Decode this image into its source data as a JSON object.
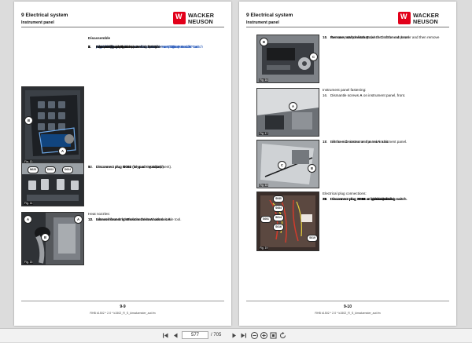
{
  "left_page": {
    "header": {
      "title": "9   Electrical system",
      "subtitle": "Instrument panel"
    },
    "logo": {
      "line1": "WACKER",
      "line2": "NEUSON",
      "mark": "W"
    },
    "disassemble_heading": "Disassemble",
    "steps_a": [
      {
        "n": "1.",
        "text": "Switch off battery master switch ",
        "bold": "S008",
        "ref": " – see \"Battery master switch"
      },
      {
        "n": "",
        "text": "",
        "bold": "",
        "ref": "S008\" on page 1-4."
      },
      {
        "n": "2.",
        "text": "Fit cladding under the instrument panel – ",
        "bold": "",
        "ref": "see \"Disassemble\" on"
      },
      {
        "n": "",
        "text": "",
        "bold": "",
        "ref": "page 12-19."
      },
      {
        "n": "3.",
        "text": "Completely remove the steering column – ",
        "bold": "",
        "ref": "see \"Disassemble\" on"
      },
      {
        "n": "",
        "text": "",
        "bold": "",
        "ref": "page 7-18."
      },
      {
        "n": "4.",
        "text": "Remove the joystick – ",
        "bold": "",
        "ref": "see \"Disassemble\" on page 9-6."
      },
      {
        "n": "5.",
        "text": "Loosen the instrument panel at the right.",
        "bold": "",
        "ref": ""
      },
      {
        "n": "",
        "text": "Operating unit, right:",
        "bold": "",
        "ref": ""
      },
      {
        "n": "6.",
        "text": "Unscrew knurled screws ",
        "bold": "A",
        "ref": ""
      },
      {
        "n": "7.",
        "text": "Lift control unit ",
        "bold": "B",
        "ref": " and place it to the side."
      }
    ],
    "steps_b": [
      {
        "n": "8.",
        "text": "Disconnect plug ",
        "bold": "N023",
        "rest": " (oil quantity adjustment)."
      },
      {
        "n": "9.",
        "text": "Disconnect plug ",
        "bold": "D003",
        "rest": " (keypad - standard)."
      },
      {
        "n": "10.",
        "text": "Disconnect plug ",
        "bold": "D004",
        "rest": " (keypad - options)."
      }
    ],
    "heater_heading": "Heat nozzles:",
    "steps_c": [
      {
        "n": "11.",
        "text": "Lift out left and right heat nozzles ",
        "bold": "A",
        "rest": " with suitable tool."
      },
      {
        "n": "12.",
        "text": "Loosen hose strap ",
        "bold": "B",
        "rest": " on the heater hoses."
      },
      {
        "n": "13.",
        "text": "Remove heater hoses from the heat nozzles ",
        "bold": "A",
        "rest": "."
      }
    ],
    "figures": [
      {
        "label": "Fig. 13",
        "callouts": [
          "B",
          "A"
        ]
      },
      {
        "label": "Fig. 14",
        "callouts": [
          "N023",
          "D003",
          "D004"
        ]
      },
      {
        "label": "Fig. 15",
        "callouts": [
          "A",
          "B",
          "A"
        ]
      }
    ],
    "page_number": "9-9",
    "footer": "RHB k1502 * 2.0 * k1502_R_S_kimaluenster_aut.fm"
  },
  "right_page": {
    "header": {
      "title": "9   Electrical system",
      "subtitle": "Instrument panel"
    },
    "logo": {
      "line1": "WACKER",
      "line2": "NEUSON",
      "mark": "W"
    },
    "steps_a": [
      {
        "n": "14.",
        "text": "Remove rotary switch ",
        "bold": "C",
        "rest": "."
      },
      {
        "n": "15.",
        "text": "Remove nut from rotary switch ",
        "bold": "C",
        "rest": " of the cab heater and then remove"
      },
      {
        "n": "",
        "text": "the rotary switch from under the instrument panel.",
        "bold": "",
        "rest": ""
      }
    ],
    "fastening_heading": "Instrument panel fastening:",
    "steps_b": [
      {
        "n": "16.",
        "text": "Dismantle screws ",
        "bold": "A",
        "rest": " on instrument panel, front."
      }
    ],
    "steps_c": [
      {
        "n": "17.",
        "text": "Lift the side instrument panel ",
        "bold": "A",
        "rest": " a bit."
      },
      {
        "n": "18.",
        "text": "Remove ",
        "bold": "C",
        "rest": " screws on the rear instrument panel."
      }
    ],
    "electrical_heading": "Electrical plug connections:",
    "steps_d": [
      {
        "n": "19.",
        "text": "Disconnect plug ",
        "bold": "S001",
        "rest": " at ignition switch."
      },
      {
        "n": "20.",
        "text": "Disconnect plug ",
        "bold": "S019",
        "rest": " at hazard warning switch."
      },
      {
        "n": "21.",
        "text": "Disconnect plug ",
        "bold": "S040",
        "rest": " at enabling switch."
      },
      {
        "n": "22.",
        "text": "Disconnect plug ",
        "bold": "S084",
        "rest": " at lock switch."
      },
      {
        "n": "23.",
        "text": "Disconnect plug ",
        "bold": "S014",
        "rest": " at light switch."
      },
      {
        "n": "24.",
        "text": "Disconnect plug ",
        "bold": "S016",
        "rest": " at blower switch."
      },
      {
        "n": "25.",
        "text": "Disconnect plug ",
        "bold": "S051",
        "rest": " at air conditioning switch."
      }
    ],
    "figures": [
      {
        "label": "Fig. 16",
        "callouts": [
          "B",
          "C"
        ]
      },
      {
        "label": "Fig. 17",
        "callouts": [
          "A"
        ]
      },
      {
        "label": "Fig. 18",
        "callouts": [
          "C",
          "B"
        ]
      },
      {
        "label": "Fig. 19",
        "callouts": [
          "S040",
          "S084",
          "S014",
          "S016",
          "S001",
          "S019"
        ]
      }
    ],
    "page_number": "9-10",
    "footer": "RHB k1502 * 2.0 * k1502_R_S_kimaluenster_aut.fm"
  },
  "toolbar": {
    "current_page": "577",
    "total_pages": "/ 705",
    "icons": [
      "first-page-icon",
      "prev-page-icon",
      "next-page-icon",
      "last-page-icon",
      "zoom-out-icon",
      "zoom-in-icon",
      "fit-page-icon",
      "rotate-icon"
    ]
  }
}
